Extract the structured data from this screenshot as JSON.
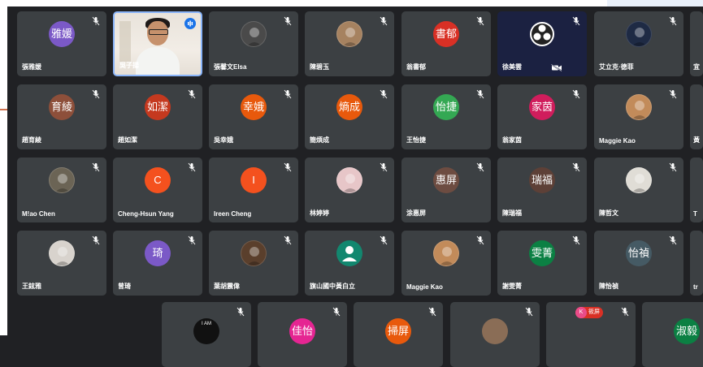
{
  "meeting": {
    "rows": [
      [
        {
          "name": "張雅媛",
          "initials": "雅媛",
          "color": "#7b59c7",
          "type": "initials"
        },
        {
          "name": "吳子揚",
          "initials": "",
          "color": "",
          "type": "self-video",
          "speaking": true
        },
        {
          "name": "張馨文Elsa",
          "initials": "",
          "color": "#4a4a4a",
          "type": "photo"
        },
        {
          "name": "陳碧玉",
          "initials": "",
          "color": "#a68260",
          "type": "photo"
        },
        {
          "name": "翁書郁",
          "initials": "書郁",
          "color": "#d93025",
          "type": "initials"
        },
        {
          "name": "徐美雲",
          "initials": "",
          "color": "",
          "type": "obs"
        },
        {
          "name": "艾立克·德菲",
          "initials": "",
          "color": "#1e2a44",
          "type": "photo"
        },
        {
          "name": "宜",
          "initials": "",
          "color": "",
          "type": "partial"
        }
      ],
      [
        {
          "name": "趙育綾",
          "initials": "育綾",
          "color": "#8d4f3a",
          "type": "initials"
        },
        {
          "name": "趙如潔",
          "initials": "如潔",
          "color": "#c5391f",
          "type": "initials"
        },
        {
          "name": "吳幸娥",
          "initials": "幸娥",
          "color": "#e8590c",
          "type": "initials"
        },
        {
          "name": "簡煩成",
          "initials": "熵成",
          "color": "#e8590c",
          "type": "initials"
        },
        {
          "name": "王怡捷",
          "initials": "怡捷",
          "color": "#34a853",
          "type": "initials"
        },
        {
          "name": "翁家茵",
          "initials": "家茵",
          "color": "#d01d5c",
          "type": "initials"
        },
        {
          "name": "Maggie Kao",
          "initials": "",
          "color": "#c28b5a",
          "type": "photo"
        },
        {
          "name": "黃",
          "initials": "",
          "color": "",
          "type": "partial"
        }
      ],
      [
        {
          "name": "M!ao Chen",
          "initials": "",
          "color": "#6b6455",
          "type": "photo"
        },
        {
          "name": "Cheng-Hsun Yang",
          "initials": "C",
          "color": "#f4511e",
          "type": "initials"
        },
        {
          "name": "Ireen Cheng",
          "initials": "I",
          "color": "#f4511e",
          "type": "initials"
        },
        {
          "name": "林婷婷",
          "initials": "",
          "color": "#e7c6c8",
          "type": "photo"
        },
        {
          "name": "涂惠屏",
          "initials": "惠屏",
          "color": "#6d4c41",
          "type": "initials"
        },
        {
          "name": "陳瑞福",
          "initials": "瑞福",
          "color": "#5d4037",
          "type": "initials"
        },
        {
          "name": "陳哲文",
          "initials": "",
          "color": "#e0ddd6",
          "type": "photo"
        },
        {
          "name": "T",
          "initials": "",
          "color": "",
          "type": "partial"
        }
      ],
      [
        {
          "name": "王鉉雅",
          "initials": "",
          "color": "#d8d3cd",
          "type": "photo"
        },
        {
          "name": "曾琦",
          "initials": "琦",
          "color": "#7b59c7",
          "type": "initials"
        },
        {
          "name": "葉胡震偉",
          "initials": "",
          "color": "#5a3f2c",
          "type": "photo"
        },
        {
          "name": "旗山國中黃白立",
          "initials": "",
          "color": "#12876f",
          "type": "default-user"
        },
        {
          "name": "Maggie Kao",
          "initials": "",
          "color": "#c28b5a",
          "type": "photo"
        },
        {
          "name": "謝雯菁",
          "initials": "雯菁",
          "color": "#0b8043",
          "type": "initials"
        },
        {
          "name": "陳怡禎",
          "initials": "怡禎",
          "color": "#455a64",
          "type": "initials"
        },
        {
          "name": "tr",
          "initials": "",
          "color": "",
          "type": "partial"
        }
      ],
      [
        {
          "name": "",
          "initials": "I AM",
          "color": "#111111",
          "type": "bottom"
        },
        {
          "name": "",
          "initials": "佳怡",
          "color": "#e52592",
          "type": "bottom"
        },
        {
          "name": "",
          "initials": "掃屏",
          "color": "#e8590c",
          "type": "bottom"
        },
        {
          "name": "",
          "initials": "",
          "color": "#8a6d56",
          "type": "bottom"
        },
        {
          "name": "",
          "initials": "",
          "color": "",
          "type": "bottom-badge",
          "badge_letter": "K",
          "badge_text": "筱屏"
        },
        {
          "name": "",
          "initials": "淑毅",
          "color": "#0b8043",
          "type": "bottom"
        }
      ]
    ],
    "colors": {
      "tile_bg": "#3c4043",
      "page_bg": "#202124",
      "active_border": "#8ab4f8"
    },
    "icons": {
      "muted": "mic-off-icon",
      "speaking": "audio-level-icon",
      "camera_off": "camera-off-icon"
    }
  }
}
